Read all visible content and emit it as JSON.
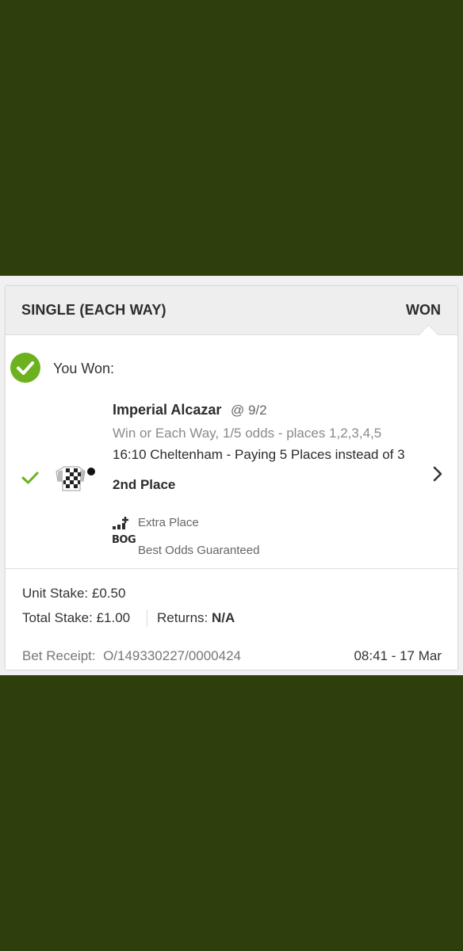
{
  "bet": {
    "type": "SINGLE (EACH WAY)",
    "status": "WON",
    "won_message": "You Won:",
    "selection": "Imperial Alcazar",
    "odds": "@ 9/2",
    "market": "Win or Each Way, 1/5 odds - places 1,2,3,4,5",
    "event": "16:10 Cheltenham - Paying 5 Places instead of 3",
    "result": "2nd Place",
    "promotions": [
      {
        "icon": "extra-place-icon",
        "label": "Extra Place"
      },
      {
        "icon": "bog-icon",
        "icon_text": "BOG",
        "label": "Best Odds Guaranteed"
      }
    ]
  },
  "summary": {
    "unit_stake_label": "Unit Stake:",
    "unit_stake_value": "£0.50",
    "total_stake_label": "Total Stake:",
    "total_stake_value": "£1.00",
    "returns_label": "Returns:",
    "returns_value": "N/A",
    "receipt_label": "Bet Receipt:",
    "receipt_value": "O/149330227/0000424",
    "timestamp": "08:41 - 17 Mar"
  },
  "colors": {
    "background": "#2e3f0b",
    "success_green": "#6cb21e",
    "header_bg": "#eeeeef"
  }
}
